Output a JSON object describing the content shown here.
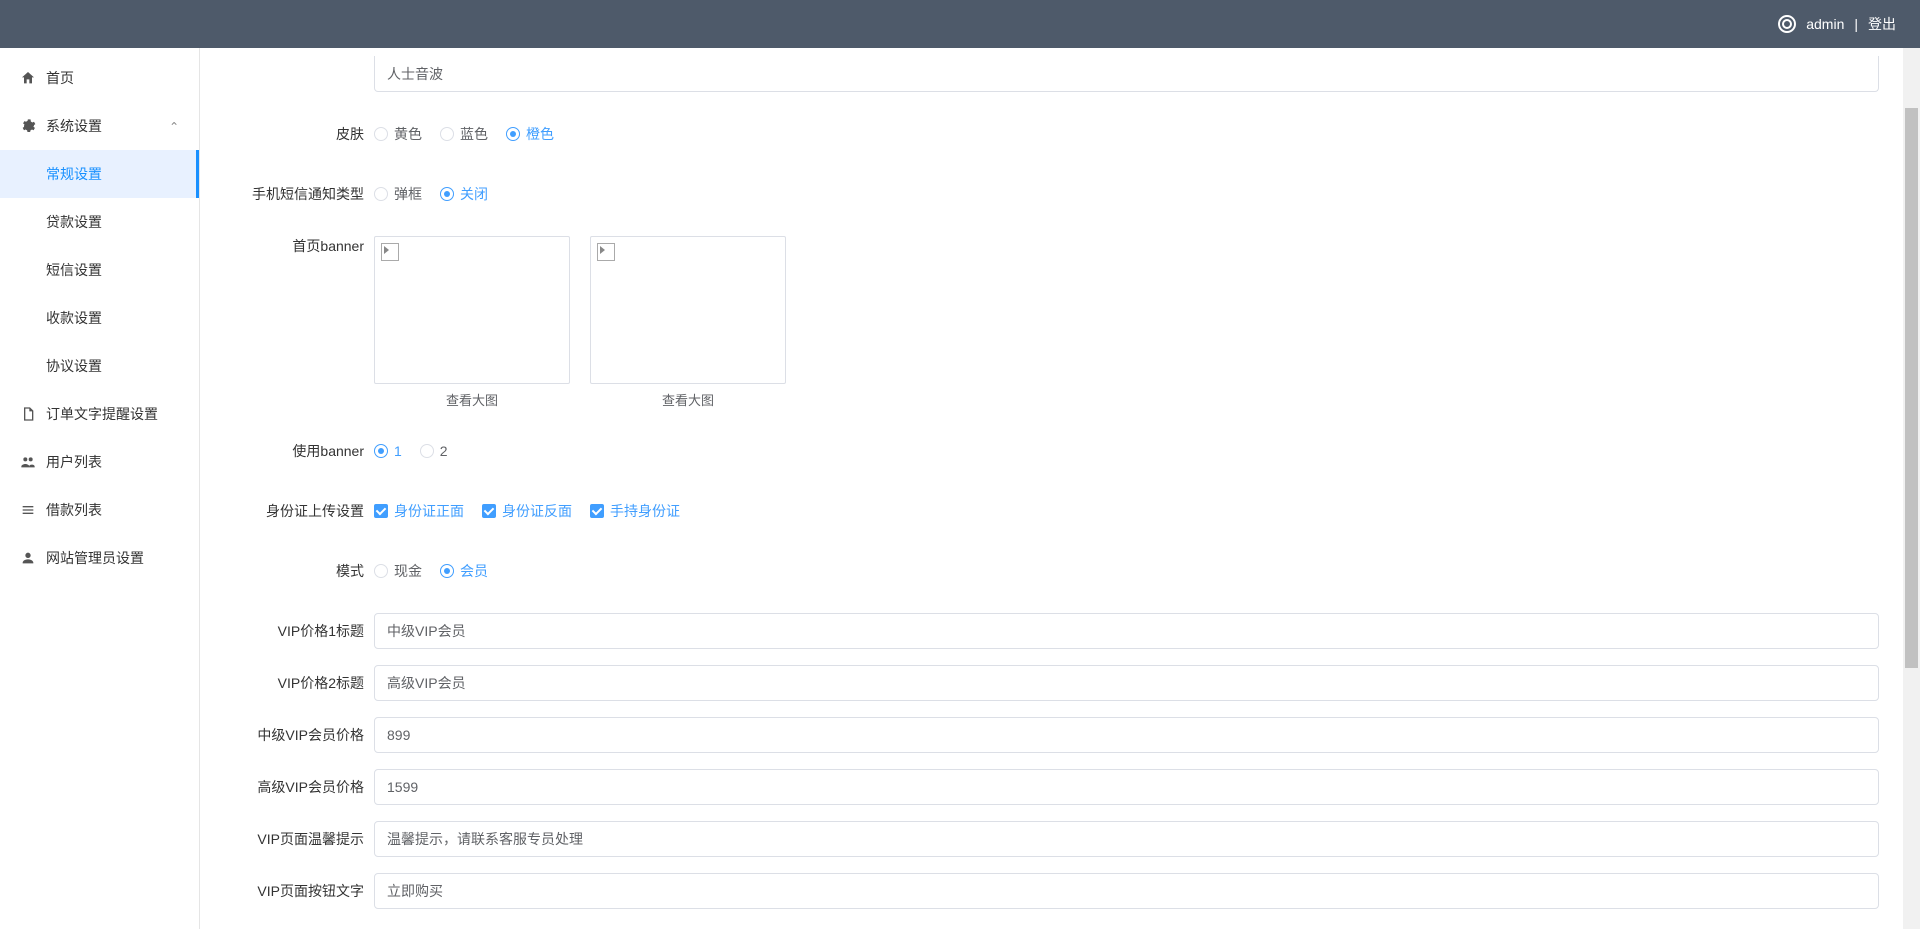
{
  "header": {
    "username": "admin",
    "separator": "|",
    "logout": "登出"
  },
  "sidebar": {
    "home": "首页",
    "system_settings": "系统设置",
    "submenu": {
      "general": "常规设置",
      "loan": "贷款设置",
      "sms": "短信设置",
      "payment": "收款设置",
      "agreement": "协议设置"
    },
    "order_reminder": "订单文字提醒设置",
    "user_list": "用户列表",
    "loan_list": "借款列表",
    "admin_settings": "网站管理员设置"
  },
  "form": {
    "cutoff_value": "人士音波",
    "skin": {
      "label": "皮肤",
      "options": {
        "yellow": "黄色",
        "blue": "蓝色",
        "orange": "橙色"
      },
      "selected": "orange"
    },
    "sms_notify": {
      "label": "手机短信通知类型",
      "options": {
        "popup": "弹框",
        "off": "关闭"
      },
      "selected": "off"
    },
    "banner": {
      "label": "首页banner",
      "view_large": "查看大图"
    },
    "use_banner": {
      "label": "使用banner",
      "options": {
        "one": "1",
        "two": "2"
      },
      "selected": "one"
    },
    "id_upload": {
      "label": "身份证上传设置",
      "options": {
        "front": "身份证正面",
        "back": "身份证反面",
        "hand": "手持身份证"
      }
    },
    "mode": {
      "label": "模式",
      "options": {
        "cash": "现金",
        "member": "会员"
      },
      "selected": "member"
    },
    "vip_title1": {
      "label": "VIP价格1标题",
      "value": "中级VIP会员"
    },
    "vip_title2": {
      "label": "VIP价格2标题",
      "value": "高级VIP会员"
    },
    "mid_vip_price": {
      "label": "中级VIP会员价格",
      "value": "899"
    },
    "high_vip_price": {
      "label": "高级VIP会员价格",
      "value": "1599"
    },
    "vip_tip": {
      "label": "VIP页面温馨提示",
      "value": "温馨提示，请联系客服专员处理"
    },
    "vip_btn_text": {
      "label": "VIP页面按钮文字",
      "value": "立即购买"
    }
  }
}
